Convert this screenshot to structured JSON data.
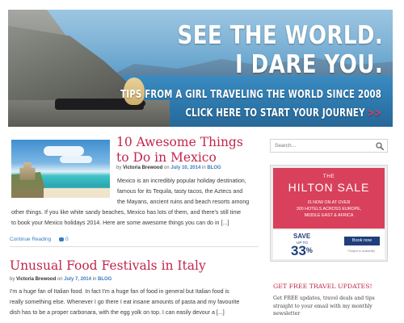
{
  "banner": {
    "headline_line1": "SEE THE WORLD.",
    "headline_line2": "I DARE YOU.",
    "tagline": "TIPS FROM A GIRL TRAVELING THE WORLD SINCE 2008",
    "cta": "CLICK HERE TO START YOUR JOURNEY",
    "cta_arrows": ">>"
  },
  "posts": [
    {
      "title": "10 Awesome Things to Do in Mexico",
      "meta": {
        "by": "by",
        "author": "Victoria Brewood",
        "on": "on",
        "date": "July 10, 2014",
        "in": "in",
        "category": "BLOG"
      },
      "excerpt_lines": [
        "Mexico is an incredibly popular holiday destination,",
        "famous for its Tequila, tasty tacos, the Aztecs and",
        "the Mayans, ancient ruins and beach resorts among",
        "other things. If you like white sandy beaches, Mexico has lots of them, and there's still time",
        "to book your Mexico holidays 2014. Here are some awesome things you can do in [...]"
      ],
      "read_more": "Continue Reading",
      "comments": "0"
    },
    {
      "title": "Unusual Food Festivals in Italy",
      "meta": {
        "by": "by",
        "author": "Victoria Brewood",
        "on": "on",
        "date": "July 7, 2014",
        "in": "in",
        "category": "BLOG"
      },
      "excerpt_lines": [
        "I'm a huge fan of Italian food. In fact I'm a huge fan of food in general but Italian food is",
        "really something else. Whenever I go there I eat insane amounts of pasta and my favourite",
        "dish has to be a proper carbonara, with the egg yolk on top. I can easily devour a [...]"
      ]
    }
  ],
  "sidebar": {
    "search": {
      "placeholder": "Search..."
    },
    "ad": {
      "the": "THE",
      "sale": "HILTON SALE",
      "sub1": "IS NOW ON AT OVER",
      "sub2": "300 HOTELS ACROSS EUROPE,",
      "sub3": "MIDDLE EAST & AFRICA",
      "save": "SAVE",
      "upto": "UP TO",
      "percent": "33",
      "percent_symbol": "%",
      "book": "Book now",
      "terms": "*Subject to availability"
    },
    "updates": {
      "title": "GET FREE TRAVEL UPDATES!",
      "text": "Get FREE updates, travel deals and tips straight to your email with my monthly newsletter"
    }
  },
  "colors": {
    "accent_title": "#c2264c",
    "link_blue": "#3a7bbf",
    "ad_red": "#d9405b",
    "ad_navy": "#1f3f7a"
  },
  "icons": {
    "search": "search-icon",
    "comment": "comment-bubble-icon"
  }
}
